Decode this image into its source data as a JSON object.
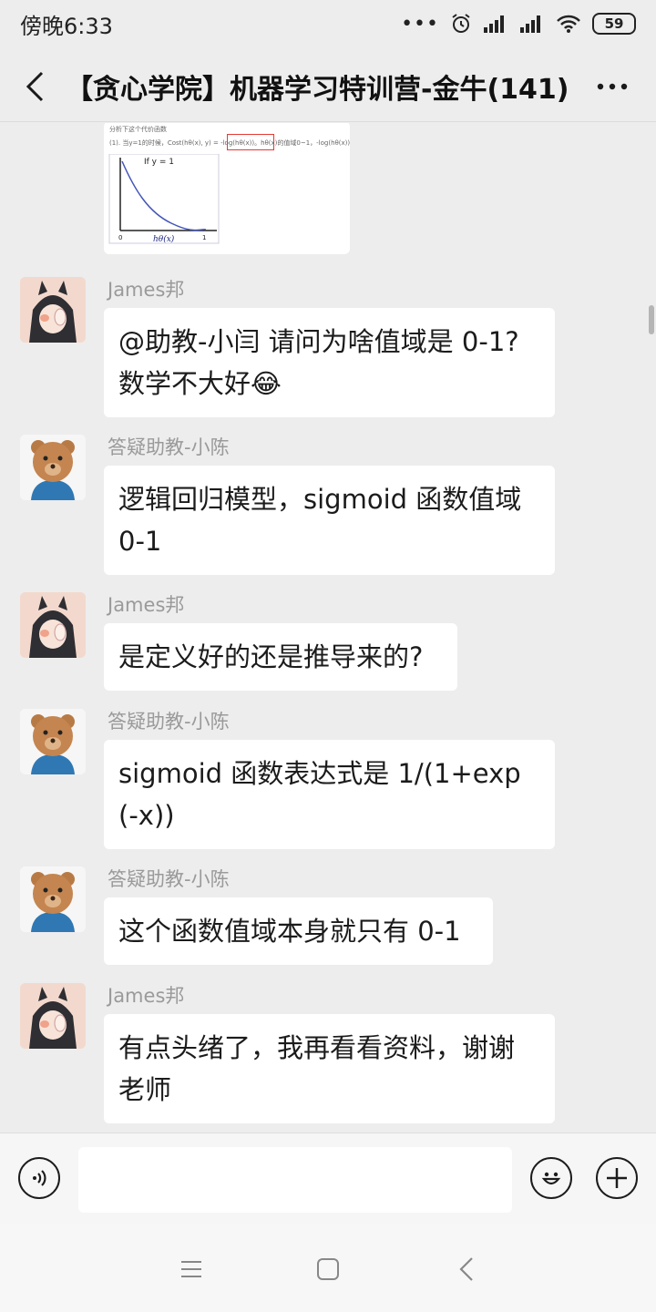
{
  "status_bar": {
    "time": "傍晚6:33",
    "battery": "59"
  },
  "header": {
    "title": "【贪心学院】机器学习特训营-金牛(141)"
  },
  "image_message": {
    "caption_top": "分析下这个代价函数",
    "caption_formula": "(1). 当y=1的时候，Cost(hθ(x), y) = -log(hθ(x))。hθ(x)的值域0~1，-log(hθ(x))的曲线图，如下",
    "plot_title": "If y = 1",
    "plot_axis_label": "hθ(x)",
    "plot_tick_0": "0",
    "plot_tick_1": "1"
  },
  "messages": [
    {
      "sender": "James邦",
      "avatar": "batman-avatar",
      "text": "@助教-小闫 请问为啥值域是 0-1?数学不大好😂"
    },
    {
      "sender": "答疑助教-小陈",
      "avatar": "bear-avatar",
      "text": "逻辑回归模型，sigmoid 函数值域 0-1"
    },
    {
      "sender": "James邦",
      "avatar": "batman-avatar",
      "text": "是定义好的还是推导来的?"
    },
    {
      "sender": "答疑助教-小陈",
      "avatar": "bear-avatar",
      "text": "sigmoid 函数表达式是 1/(1+exp(-x))"
    },
    {
      "sender": "答疑助教-小陈",
      "avatar": "bear-avatar",
      "text": "这个函数值域本身就只有 0-1"
    },
    {
      "sender": "James邦",
      "avatar": "batman-avatar",
      "text": "有点头绪了，我再看看资料，谢谢老师"
    }
  ],
  "input": {
    "placeholder": ""
  },
  "icons": {
    "voice": "voice-icon",
    "emoji": "emoji-icon",
    "add": "plus-icon",
    "menu": "menu-icon",
    "home": "home-icon",
    "back": "back-icon"
  }
}
